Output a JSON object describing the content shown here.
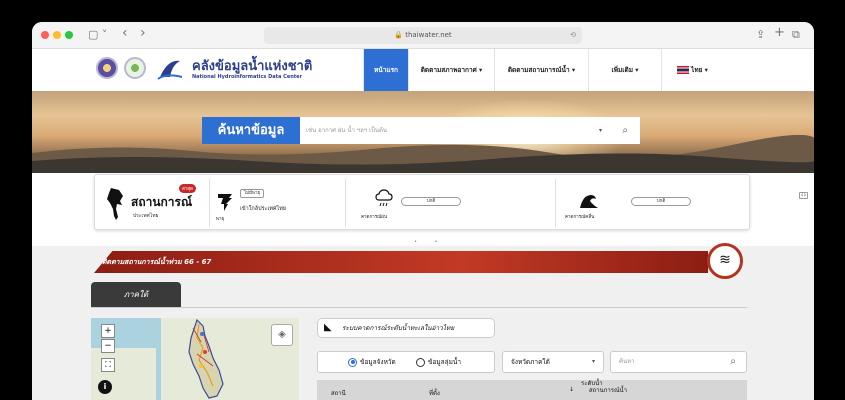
{
  "browser": {
    "url": "thaiwater.net",
    "back": "‹",
    "forward": "›",
    "sidebar_icon": "▢ ˅"
  },
  "brand": {
    "title": "คลังข้อมูลน้ำแห่งชาติ",
    "subtitle": "National Hydroinformatics Data Center"
  },
  "nav": {
    "items": [
      {
        "label": "หน้าแรก",
        "active": true
      },
      {
        "label": "ติดตามสภาพอากาศ ▾"
      },
      {
        "label": "ติดตามสถานการณ์น้ำ ▾"
      },
      {
        "label": "เพิ่มเติม ▾"
      },
      {
        "label": "ไทย ▾"
      }
    ]
  },
  "search": {
    "label": "ค้นหาข้อมูล",
    "placeholder": "เช่น อากาศ ฝน น้ำ ฯลฯ เป็นต้น"
  },
  "situation": {
    "title": "สถานการณ์",
    "subtitle": "ประเทศไทย",
    "badge": "ล่าสุด",
    "storm_badge": "ไม่มีพายุ",
    "storm_label": "พายุ",
    "storm_text": "เข้าใกล้ประเทศไทย",
    "rain_label": "คาดการณ์ฝน",
    "rain_status": "ปกติ",
    "wave_label": "คาดการณ์คลื่น",
    "wave_status": "ปกติ"
  },
  "ribbon": {
    "text": "ติดตามสถานการณ์น้ำท่วม 66 - 67"
  },
  "region_tab": "ภาคใต้",
  "map": {
    "zoom_in": "+",
    "zoom_out": "−",
    "fullscreen": "⛶",
    "info": "i"
  },
  "storm_pill": "ระบบคาดการณ์ระดับน้ำทะเลในอ่าวไทย",
  "filter": {
    "option_province": "ข้อมูลจังหวัด",
    "option_basin": "ข้อมูลลุ่มน้ำ",
    "province_select": "จังหวัดภาคใต้",
    "search_placeholder": "ค้นหา"
  },
  "table": {
    "col_station": "สถานี",
    "col_location": "ที่ตั้ง",
    "col_level_top": "ระดับน้ำ",
    "col_level_bottom": "สถานการณ์น้ำ"
  },
  "colors": {
    "primary": "#2e6fd3",
    "ribbon": "#b2331f",
    "brand": "#2d3e8c"
  }
}
